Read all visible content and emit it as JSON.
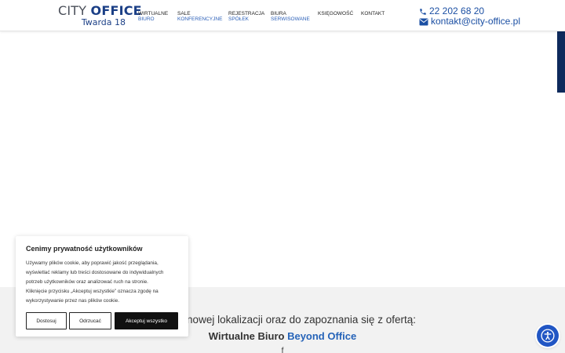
{
  "logo": {
    "name_part1": "CITY ",
    "name_part2": "OFFICE",
    "subtitle": "Twarda 18"
  },
  "nav": [
    {
      "line1": "WIRTUALNE",
      "line2": "BIURO"
    },
    {
      "line1": "SALE",
      "line2": "KONFERENCYJNE"
    },
    {
      "line1": "REJESTRACJA",
      "line2": "SPÓŁEK"
    },
    {
      "line1": "BIURA",
      "line2": "SERWISOWANE"
    },
    {
      "line1": "KSIĘGOWOŚĆ",
      "line2": ""
    },
    {
      "line1": "KONTAKT",
      "line2": ""
    }
  ],
  "contact": {
    "phone": "22 202 68 20",
    "email": "kontakt@city-office.pl",
    "phone_icon": "phone-icon",
    "email_icon": "envelope-icon"
  },
  "banner": {
    "line1": "amy do nowej lokalizacji oraz do zapoznania się z ofertą:",
    "line2_prefix": "Wirtualne Biuro ",
    "line2_highlight": "Beyond Office",
    "line3": "f"
  },
  "cookie": {
    "title": "Cenimy prywatność użytkowników",
    "text_lines": [
      "Używamy plików cookie, aby poprawić jakość przeglądania,",
      "wyświetlać reklamy lub treści dostosowane do indywidualnych",
      "potrzeb użytkowników oraz analizować ruch na stronie.",
      "Kliknięcie przycisku „Akceptuj wszystkie” oznacza zgodę na",
      "wykorzystywanie przez nas plików cookie."
    ],
    "customize_label": "Dostosuj",
    "reject_label": "Odrzucać",
    "accept_label": "Akceptuj wszystko"
  },
  "accessibility": {
    "icon": "accessibility-icon"
  },
  "colors": {
    "brand_blue": "#1b3f86",
    "link_blue": "#2563b8",
    "dark_tab": "#0e2a5c",
    "a11y_blue": "#2156c4"
  }
}
